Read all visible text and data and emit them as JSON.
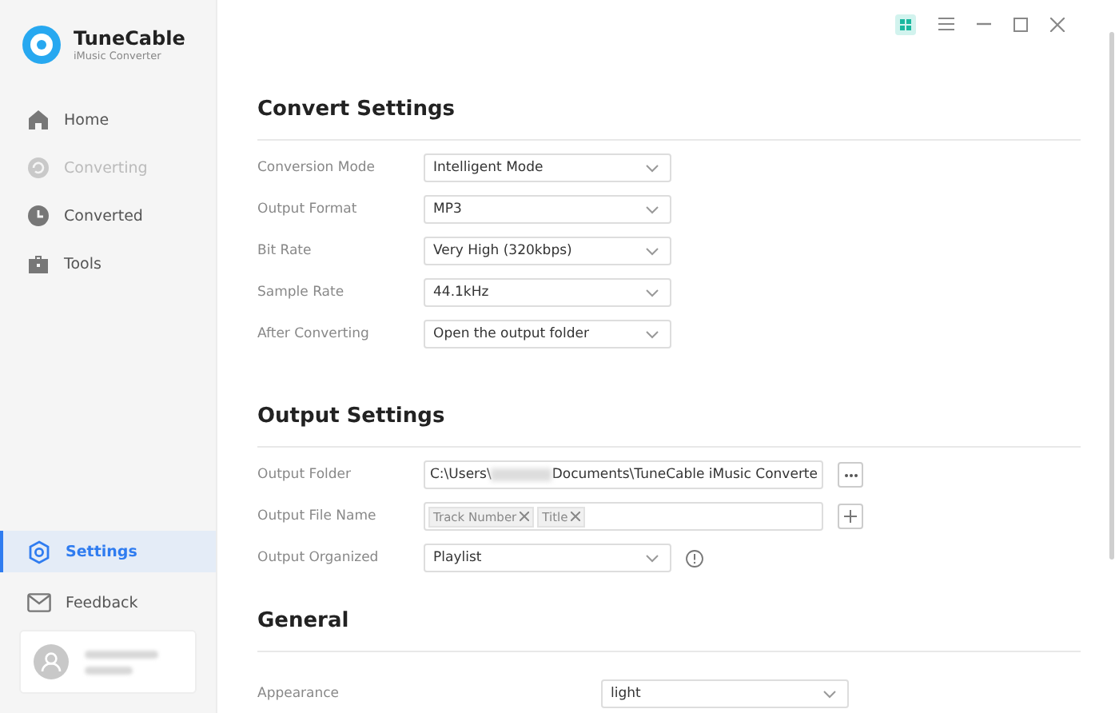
{
  "app": {
    "name": "TuneCable",
    "subtitle": "iMusic Converter"
  },
  "nav": [
    {
      "label": "Home",
      "selected": false,
      "disabled": false
    },
    {
      "label": "Converting",
      "selected": false,
      "disabled": true
    },
    {
      "label": "Converted",
      "selected": false,
      "disabled": false
    },
    {
      "label": "Tools",
      "selected": false,
      "disabled": false
    }
  ],
  "nav_bottom": [
    {
      "label": "Settings",
      "selected": true,
      "disabled": false
    },
    {
      "label": "Feedback",
      "selected": false,
      "disabled": false
    }
  ],
  "sections": [
    {
      "title": "Convert Settings",
      "rows": [
        {
          "kind": "select",
          "label": "Conversion Mode",
          "value": "Intelligent Mode"
        },
        {
          "kind": "select",
          "label": "Output Format",
          "value": "MP3"
        },
        {
          "kind": "select",
          "label": "Bit Rate",
          "value": "Very High (320kbps)"
        },
        {
          "kind": "select",
          "label": "Sample Rate",
          "value": "44.1kHz"
        },
        {
          "kind": "select",
          "label": "After Converting",
          "value": "Open the output folder"
        }
      ]
    },
    {
      "title": "Output Settings",
      "rows": [
        {
          "kind": "path",
          "label": "Output Folder",
          "value_start": "C:\\Users\\",
          "value_end": "Documents\\TuneCable iMusic Converte"
        },
        {
          "kind": "tags",
          "label": "Output File Name",
          "tags": [
            "Track Number",
            "Title"
          ]
        },
        {
          "kind": "select",
          "label": "Output Organized",
          "value": "Playlist",
          "info": true
        }
      ]
    },
    {
      "title": "General",
      "rows": [
        {
          "kind": "select",
          "label": "Appearance",
          "value": "light"
        }
      ]
    }
  ]
}
